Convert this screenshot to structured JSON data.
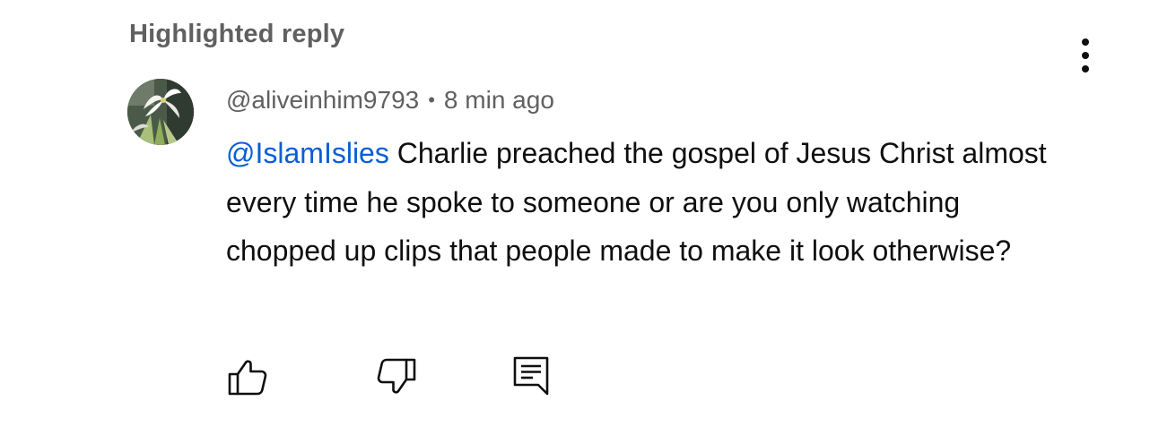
{
  "section": {
    "label": "Highlighted reply"
  },
  "comment": {
    "author": "@aliveinhim9793",
    "separator": "•",
    "time": "8 min ago",
    "mention": "@IslamIslies",
    "text": " Charlie preached the gospel of Jesus Christ almost every time he spoke to someone or are you only watching chopped up clips that people made to make it look otherwise?"
  },
  "actions": {
    "like_icon": "thumbs-up-icon",
    "dislike_icon": "thumbs-down-icon",
    "reply_icon": "comment-reply-icon",
    "more_icon": "more-vertical-icon"
  },
  "colors": {
    "text": "#0f0f0f",
    "secondary": "#606060",
    "mention": "#065fd4",
    "background": "#ffffff"
  }
}
